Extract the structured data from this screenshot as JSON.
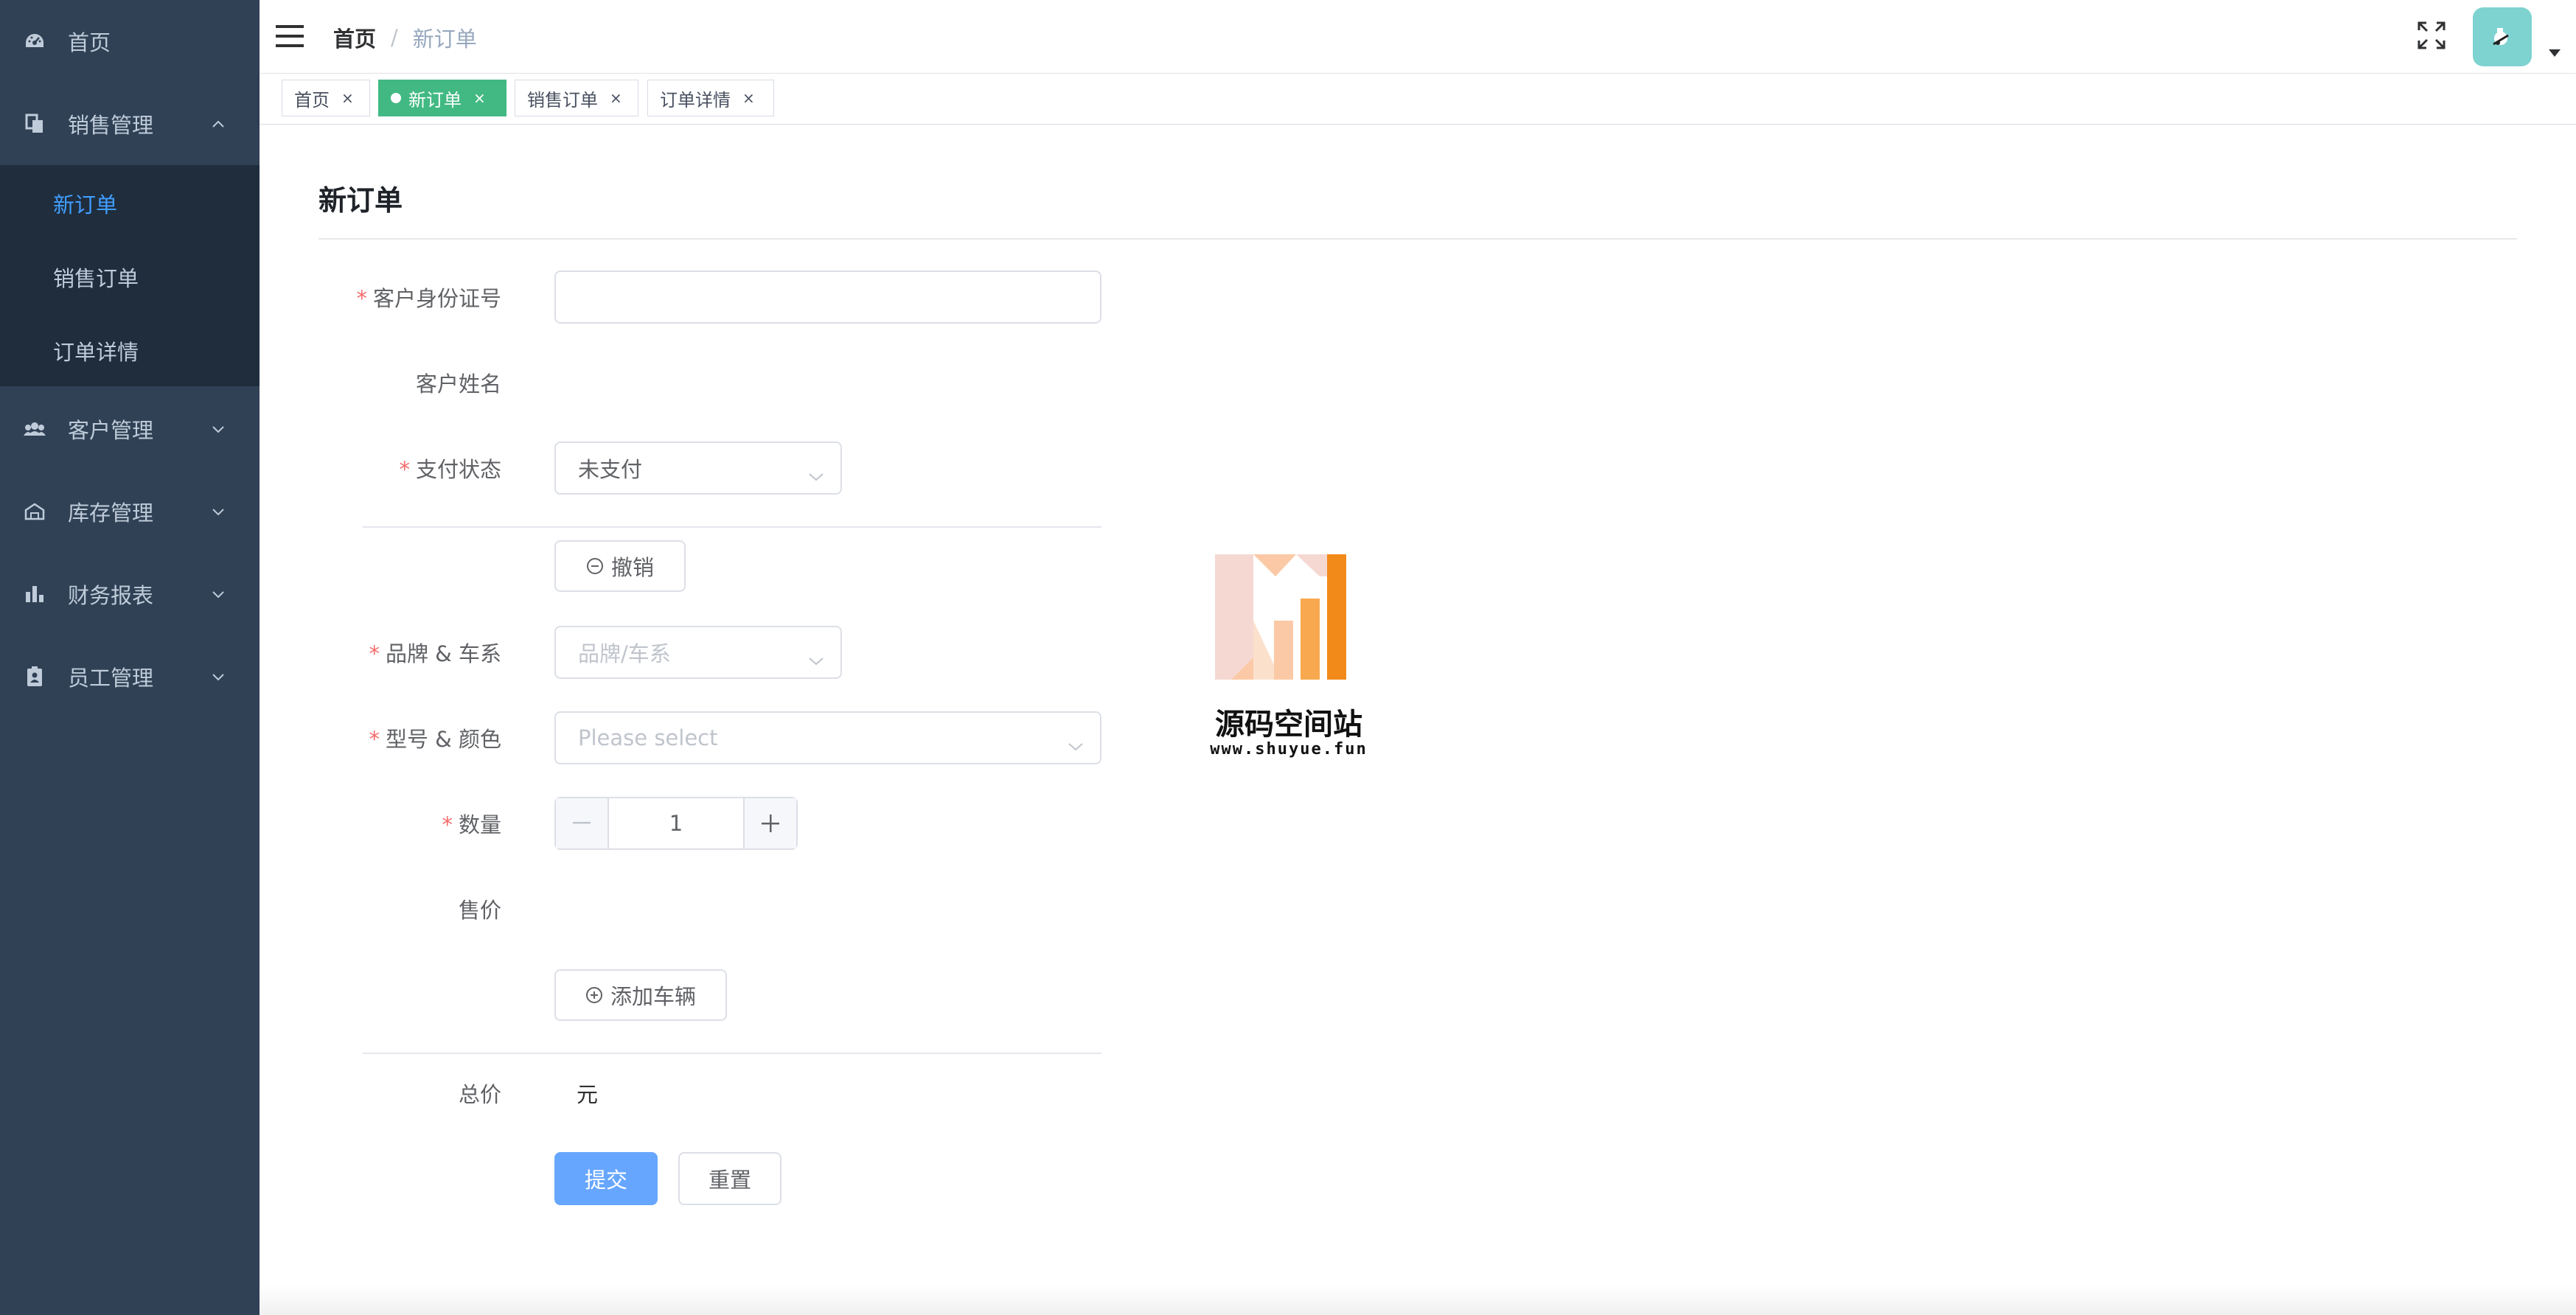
{
  "sidebar": {
    "items": [
      {
        "label": "首页",
        "icon": "dashboard-icon"
      },
      {
        "label": "销售管理",
        "icon": "sales-icon",
        "expanded": true,
        "children": [
          {
            "label": "新订单",
            "active": true
          },
          {
            "label": "销售订单"
          },
          {
            "label": "订单详情"
          }
        ]
      },
      {
        "label": "客户管理",
        "icon": "people-icon"
      },
      {
        "label": "库存管理",
        "icon": "warehouse-icon"
      },
      {
        "label": "财务报表",
        "icon": "chart-icon"
      },
      {
        "label": "员工管理",
        "icon": "badge-icon"
      }
    ]
  },
  "navbar": {
    "breadcrumb": [
      "首页",
      "新订单"
    ],
    "separator": "/"
  },
  "tags": [
    {
      "label": "首页",
      "active": false
    },
    {
      "label": "新订单",
      "active": true
    },
    {
      "label": "销售订单",
      "active": false
    },
    {
      "label": "订单详情",
      "active": false
    }
  ],
  "tag_close": "×",
  "page": {
    "title": "新订单"
  },
  "form": {
    "required_mark": "*",
    "customer_id": {
      "label": "客户身份证号",
      "value": ""
    },
    "customer_name": {
      "label": "客户姓名",
      "value": ""
    },
    "payment_status": {
      "label": "支付状态",
      "value": "未支付"
    },
    "revoke_button": "撤销",
    "brand_series": {
      "label": "品牌 & 车系",
      "placeholder": "品牌/车系"
    },
    "model_color": {
      "label": "型号 & 颜色",
      "placeholder": "Please select"
    },
    "quantity": {
      "label": "数量",
      "value": "1"
    },
    "price": {
      "label": "售价",
      "value": ""
    },
    "add_vehicle_button": "添加车辆",
    "total": {
      "label": "总价",
      "value": "元"
    },
    "submit_button": "提交",
    "reset_button": "重置"
  },
  "watermark": {
    "title": "源码空间站",
    "url": "www.shuyue.fun"
  },
  "colors": {
    "sidebar_bg": "#304156",
    "submenu_bg": "#1f2d3d",
    "active_menu": "#409eff",
    "active_tag": "#42b983",
    "primary_button": "#66a6ff",
    "required": "#f56c6c"
  }
}
